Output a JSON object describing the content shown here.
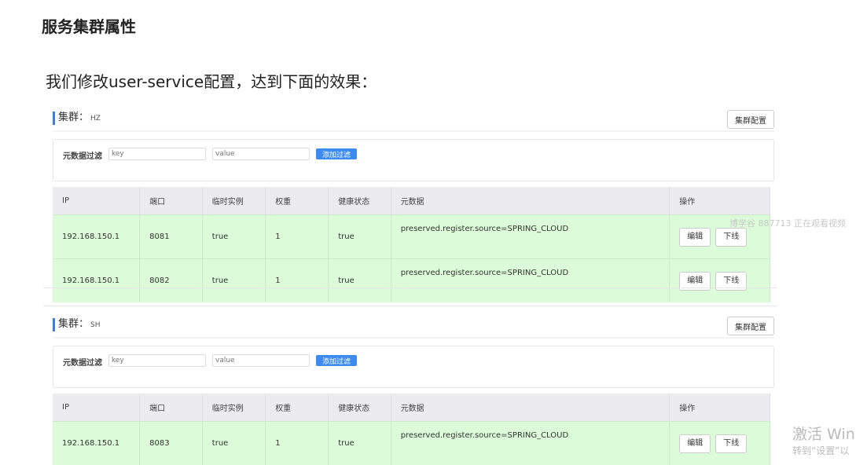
{
  "title": "服务集群属性",
  "subtitle": "我们修改user-service配置，达到下面的效果：",
  "cluster_label": "集群：",
  "cluster_config_label": "集群配置",
  "filter": {
    "label": "元数据过滤",
    "key_placeholder": "key",
    "value_placeholder": "value",
    "add_label": "添加过滤"
  },
  "columns": [
    "IP",
    "端口",
    "临时实例",
    "权重",
    "健康状态",
    "元数据",
    "操作"
  ],
  "actions": {
    "edit": "编辑",
    "offline": "下线"
  },
  "clusters": [
    {
      "name": "HZ",
      "rows": [
        {
          "ip": "192.168.150.1",
          "port": "8081",
          "ephemeral": "true",
          "weight": "1",
          "healthy": "true",
          "metadata": "preserved.register.source=SPRING_CLOUD"
        },
        {
          "ip": "192.168.150.1",
          "port": "8082",
          "ephemeral": "true",
          "weight": "1",
          "healthy": "true",
          "metadata": "preserved.register.source=SPRING_CLOUD"
        }
      ]
    },
    {
      "name": "SH",
      "rows": [
        {
          "ip": "192.168.150.1",
          "port": "8083",
          "ephemeral": "true",
          "weight": "1",
          "healthy": "true",
          "metadata": "preserved.register.source=SPRING_CLOUD"
        }
      ]
    }
  ],
  "watermark": "博学谷 887713 正在观看视频",
  "activation": {
    "line1": "激活 Win",
    "line2": "转到“设置”以"
  }
}
